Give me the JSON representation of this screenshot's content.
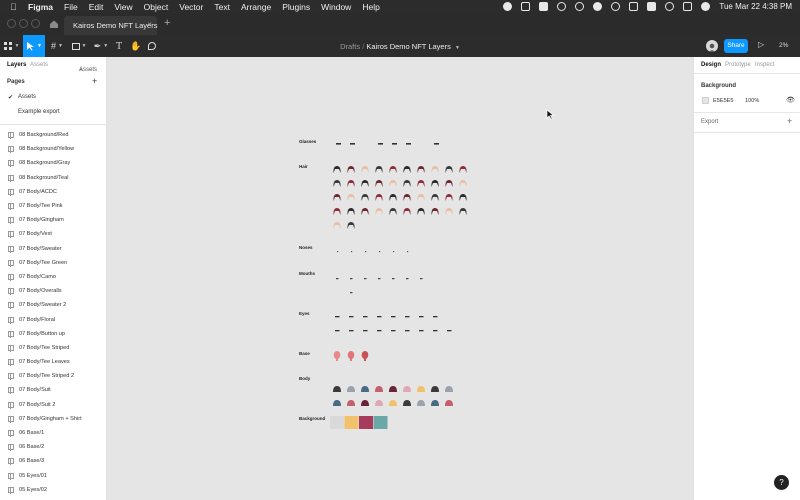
{
  "menubar": {
    "app_name": "Figma",
    "items": [
      "File",
      "Edit",
      "View",
      "Object",
      "Vector",
      "Text",
      "Arrange",
      "Plugins",
      "Window",
      "Help"
    ],
    "clock": "Tue Mar 22  4:38 PM"
  },
  "tabs": [
    {
      "label": "Kairos Demo NFT Layers",
      "close": "×"
    }
  ],
  "new_tab": "+",
  "toolbar": {
    "breadcrumb_parent": "Drafts",
    "separator": "/",
    "file_name": "Kairos Demo NFT Layers",
    "share_label": "Share",
    "zoom": "2%"
  },
  "left_panel": {
    "tab_layers": "Layers",
    "tab_assets": "Assets",
    "tab_assets_menu": "Assets",
    "pages_title": "Pages",
    "pages_add": "+",
    "pages": [
      {
        "label": "Assets",
        "active": true
      },
      {
        "label": "Example export",
        "active": false
      }
    ],
    "layers": [
      "08 Background/Red",
      "08 Background/Yellow",
      "08 Background/Gray",
      "08 Background/Teal",
      "07 Body/ACDC",
      "07 Body/Tee Pink",
      "07 Body/Gingham",
      "07 Body/Vest",
      "07 Body/Sweater",
      "07 Body/Tee Green",
      "07 Body/Camo",
      "07 Body/Overalls",
      "07 Body/Sweater 2",
      "07 Body/Floral",
      "07 Body/Button up",
      "07 Body/Tee Striped",
      "07 Body/Tee Leaves",
      "07 Body/Tee Striped 2",
      "07 Body/Suit",
      "07 Body/Suit 2",
      "07 Body/Gingham + Shirt",
      "06 Base/1",
      "06 Base/2",
      "06 Base/3",
      "05 Eyes/01",
      "05 Eyes/02"
    ]
  },
  "right_panel": {
    "tab_design": "Design",
    "tab_prototype": "Prototype",
    "tab_inspect": "Inspect",
    "background_title": "Background",
    "background_hex": "E5E5E5",
    "background_opacity": "100%",
    "export_label": "Export",
    "export_add": "+"
  },
  "canvas": {
    "sections": [
      "Glasses",
      "Hair",
      "Noses",
      "Mouths",
      "Eyes",
      "Base",
      "Body",
      "Background"
    ],
    "background_swatches": [
      "#d9d9d9",
      "#f2c16b",
      "#a83a5c",
      "#6ca7a8"
    ],
    "base_colors": [
      "#e88a8a",
      "#e27676",
      "#c95252"
    ],
    "hair_colors": [
      "#2b2b2b",
      "#6b2a2f",
      "#e8bfa4",
      "#3b3b3b",
      "#8f2f3c"
    ],
    "body_colors": [
      "#3b3b3b",
      "#9aa3ad",
      "#486a84",
      "#c4606e",
      "#6b2438",
      "#e0a8b4",
      "#f2c16b"
    ]
  },
  "help_label": "?"
}
